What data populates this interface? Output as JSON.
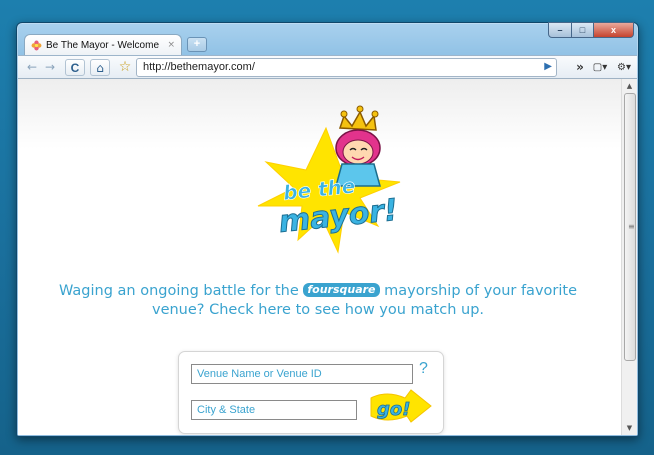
{
  "browser": {
    "tab_title": "Be The Mayor - Welcome",
    "tab_close": "×",
    "new_tab": "+",
    "url": "http://bethemayor.com/",
    "window_controls": {
      "minimize": "–",
      "maximize": "□",
      "close": "x"
    },
    "toolbar": {
      "back": "←",
      "forward": "→",
      "reload": "C",
      "home": "⌂",
      "star": "☆",
      "go": "▶",
      "more": "»",
      "page": "▢▾",
      "tools": "⚙▾"
    }
  },
  "page": {
    "logo": {
      "line1": "be the",
      "line2": "mayor!"
    },
    "tagline": {
      "before": "Waging an ongoing battle for the",
      "brand": "foursquare",
      "after": "mayorship of your favorite venue? Check here to see how you match up."
    },
    "form": {
      "venue_placeholder": "Venue Name or Venue ID",
      "city_placeholder": "City & State",
      "help": "?",
      "go_label": "go!"
    }
  },
  "colors": {
    "accent": "#3aa3cf",
    "star": "#ffe400",
    "desktop": "#1a6f9c"
  }
}
